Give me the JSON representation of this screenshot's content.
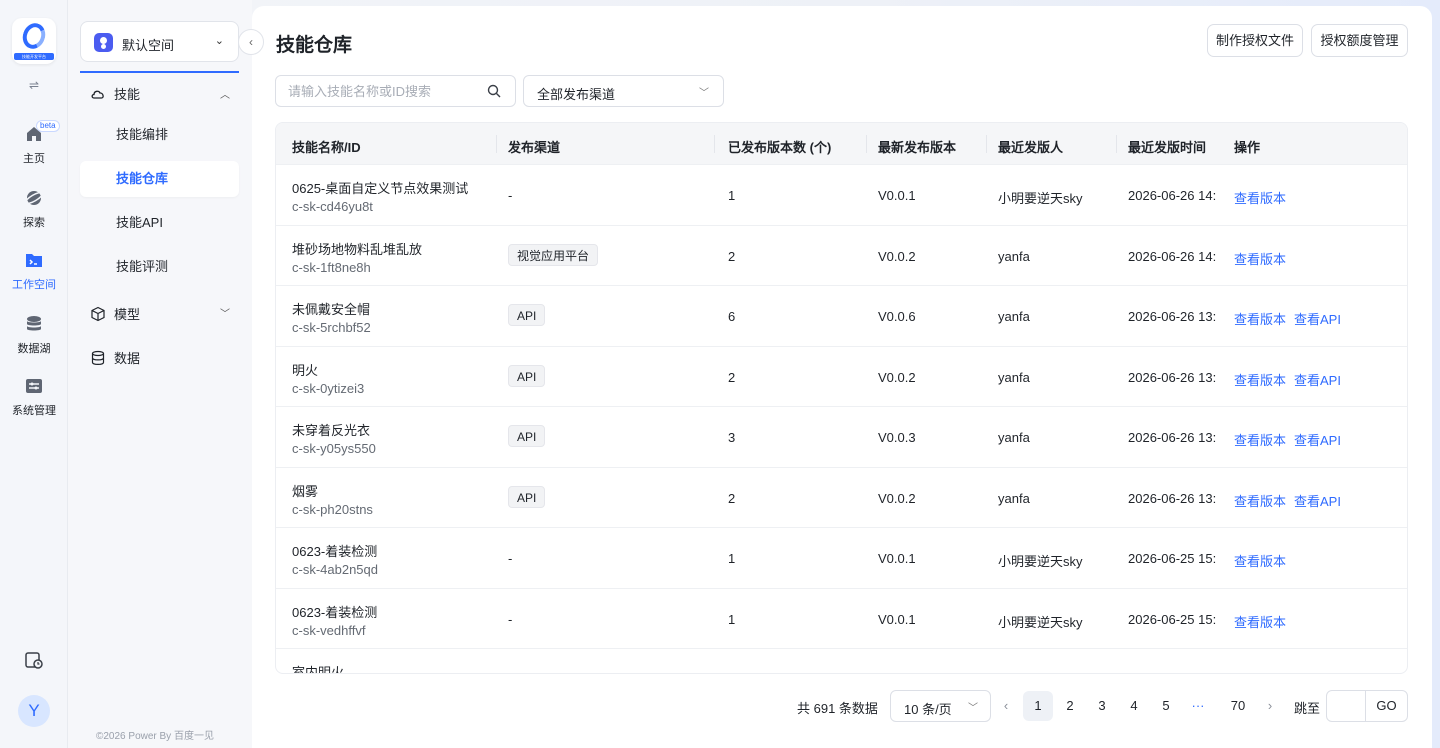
{
  "rail": {
    "logo_caption": "技能开发平台",
    "items": [
      {
        "label": "主页",
        "badge": "beta"
      },
      {
        "label": "探索"
      },
      {
        "label": "工作空间"
      },
      {
        "label": "数据湖"
      },
      {
        "label": "系统管理"
      }
    ],
    "avatar": "Y"
  },
  "sidebar": {
    "space": "默认空间",
    "group_skill": "技能",
    "sub_items": [
      "技能编排",
      "技能仓库",
      "技能API",
      "技能评测"
    ],
    "group_model": "模型",
    "group_data": "数据",
    "copyright": "©2026 Power By 百度一见"
  },
  "header": {
    "title": "技能仓库",
    "btn_license": "制作授权文件",
    "btn_quota": "授权额度管理"
  },
  "filters": {
    "search_placeholder": "请输入技能名称或ID搜索",
    "channel": "全部发布渠道"
  },
  "table": {
    "columns": [
      "技能名称/ID",
      "发布渠道",
      "已发布版本数 (个)",
      "最新发布版本",
      "最近发版人",
      "最近发版时间",
      "操作"
    ],
    "rows": [
      {
        "name": "0625-桌面自定义节点效果测试",
        "id": "c-sk-cd46yu8t",
        "channel": "-",
        "count": "1",
        "version": "V0.0.1",
        "publisher": "小明要逆天sky",
        "time": "2026-06-26 14:",
        "actions": [
          "查看版本"
        ]
      },
      {
        "name": "堆砂场地物料乱堆乱放",
        "id": "c-sk-1ft8ne8h",
        "channel_tag": "视觉应用平台",
        "count": "2",
        "version": "V0.0.2",
        "publisher": "yanfa",
        "time": "2026-06-26 14:",
        "actions": [
          "查看版本"
        ]
      },
      {
        "name": "未佩戴安全帽",
        "id": "c-sk-5rchbf52",
        "channel_tag": "API",
        "count": "6",
        "version": "V0.0.6",
        "publisher": "yanfa",
        "time": "2026-06-26 13:",
        "actions": [
          "查看版本",
          "查看API"
        ]
      },
      {
        "name": "明火",
        "id": "c-sk-0ytizei3",
        "channel_tag": "API",
        "count": "2",
        "version": "V0.0.2",
        "publisher": "yanfa",
        "time": "2026-06-26 13:",
        "actions": [
          "查看版本",
          "查看API"
        ]
      },
      {
        "name": "未穿着反光衣",
        "id": "c-sk-y05ys550",
        "channel_tag": "API",
        "count": "3",
        "version": "V0.0.3",
        "publisher": "yanfa",
        "time": "2026-06-26 13:",
        "actions": [
          "查看版本",
          "查看API"
        ]
      },
      {
        "name": "烟雾",
        "id": "c-sk-ph20stns",
        "channel_tag": "API",
        "count": "2",
        "version": "V0.0.2",
        "publisher": "yanfa",
        "time": "2026-06-26 13:",
        "actions": [
          "查看版本",
          "查看API"
        ]
      },
      {
        "name": "0623-着装检测",
        "id": "c-sk-4ab2n5qd",
        "channel": "-",
        "count": "1",
        "version": "V0.0.1",
        "publisher": "小明要逆天sky",
        "time": "2026-06-25 15:",
        "actions": [
          "查看版本"
        ]
      },
      {
        "name": "0623-着装检测",
        "id": "c-sk-vedhffvf",
        "channel": "-",
        "count": "1",
        "version": "V0.0.1",
        "publisher": "小明要逆天sky",
        "time": "2026-06-25 15:",
        "actions": [
          "查看版本"
        ]
      },
      {
        "name": "室内明火",
        "id": "",
        "channel": "",
        "count": "",
        "version": "",
        "publisher": "",
        "time": "",
        "actions": []
      }
    ]
  },
  "pagination": {
    "total": "共 691 条数据",
    "page_size": "10 条/页",
    "pages": [
      "1",
      "2",
      "3",
      "4",
      "5"
    ],
    "ellipsis": "···",
    "last": "70",
    "jump_label": "跳至",
    "go": "GO"
  },
  "colors": {
    "accent": "#2f6bff"
  }
}
